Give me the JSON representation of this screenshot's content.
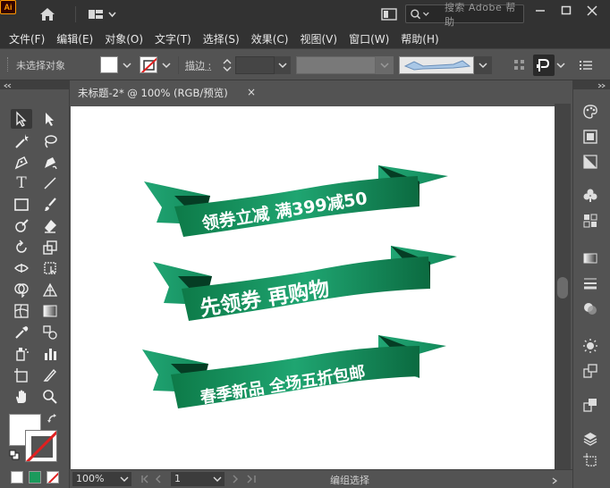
{
  "app": {
    "logo_text": "Ai",
    "search_placeholder": "搜索 Adobe 帮助"
  },
  "menu": {
    "items": [
      "文件(F)",
      "编辑(E)",
      "对象(O)",
      "文字(T)",
      "选择(S)",
      "效果(C)",
      "视图(V)",
      "窗口(W)",
      "帮助(H)"
    ]
  },
  "controlbar": {
    "selection_status": "未选择对象",
    "stroke_label": "描边 :"
  },
  "document": {
    "tab_title": "未标题-2* @ 100% (RGB/预览)",
    "close_glyph": "×"
  },
  "artwork": {
    "ribbons": [
      {
        "text": "领券立减  满399减50"
      },
      {
        "text": "先领券  再购物"
      },
      {
        "text": "春季新品  全场五折包邮"
      }
    ],
    "colors": {
      "ribbon_light": "#1fa571",
      "ribbon_dark": "#0b6a40",
      "fold": "#053d24"
    }
  },
  "statusbar": {
    "zoom": "100%",
    "artboard_number": "1",
    "status": "编组选择"
  }
}
